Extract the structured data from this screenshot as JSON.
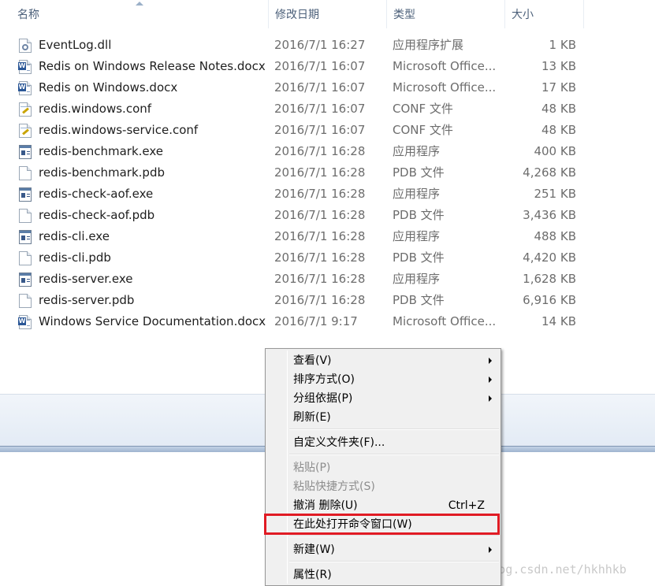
{
  "columns": {
    "name": "名称",
    "modified": "修改日期",
    "type": "类型",
    "size": "大小"
  },
  "files": [
    {
      "name": "EventLog.dll",
      "modified": "2016/7/1 16:27",
      "type": "应用程序扩展",
      "size": "1 KB",
      "icon": "dll-file-icon"
    },
    {
      "name": "Redis on Windows Release Notes.docx",
      "modified": "2016/7/1 16:07",
      "type": "Microsoft Office...",
      "size": "13 KB",
      "icon": "word-document-icon"
    },
    {
      "name": "Redis on Windows.docx",
      "modified": "2016/7/1 16:07",
      "type": "Microsoft Office...",
      "size": "17 KB",
      "icon": "word-document-icon"
    },
    {
      "name": "redis.windows.conf",
      "modified": "2016/7/1 16:07",
      "type": "CONF 文件",
      "size": "48 KB",
      "icon": "config-file-icon"
    },
    {
      "name": "redis.windows-service.conf",
      "modified": "2016/7/1 16:07",
      "type": "CONF 文件",
      "size": "48 KB",
      "icon": "config-file-icon"
    },
    {
      "name": "redis-benchmark.exe",
      "modified": "2016/7/1 16:28",
      "type": "应用程序",
      "size": "400 KB",
      "icon": "exe-file-icon"
    },
    {
      "name": "redis-benchmark.pdb",
      "modified": "2016/7/1 16:28",
      "type": "PDB 文件",
      "size": "4,268 KB",
      "icon": "blank-file-icon"
    },
    {
      "name": "redis-check-aof.exe",
      "modified": "2016/7/1 16:28",
      "type": "应用程序",
      "size": "251 KB",
      "icon": "exe-file-icon"
    },
    {
      "name": "redis-check-aof.pdb",
      "modified": "2016/7/1 16:28",
      "type": "PDB 文件",
      "size": "3,436 KB",
      "icon": "blank-file-icon"
    },
    {
      "name": "redis-cli.exe",
      "modified": "2016/7/1 16:28",
      "type": "应用程序",
      "size": "488 KB",
      "icon": "exe-file-icon"
    },
    {
      "name": "redis-cli.pdb",
      "modified": "2016/7/1 16:28",
      "type": "PDB 文件",
      "size": "4,420 KB",
      "icon": "blank-file-icon"
    },
    {
      "name": "redis-server.exe",
      "modified": "2016/7/1 16:28",
      "type": "应用程序",
      "size": "1,628 KB",
      "icon": "exe-file-icon"
    },
    {
      "name": "redis-server.pdb",
      "modified": "2016/7/1 16:28",
      "type": "PDB 文件",
      "size": "6,916 KB",
      "icon": "blank-file-icon"
    },
    {
      "name": "Windows Service Documentation.docx",
      "modified": "2016/7/1 9:17",
      "type": "Microsoft Office...",
      "size": "14 KB",
      "icon": "word-document-icon"
    }
  ],
  "context_menu": {
    "view": "查看(V)",
    "sort_by": "排序方式(O)",
    "group_by": "分组依据(P)",
    "refresh": "刷新(E)",
    "customize_folder": "自定义文件夹(F)...",
    "paste": "粘贴(P)",
    "paste_shortcut": "粘贴快捷方式(S)",
    "undo_delete": "撤消 删除(U)",
    "undo_shortcut": "Ctrl+Z",
    "open_command_window": "在此处打开命令窗口(W)",
    "new": "新建(W)",
    "properties": "属性(R)"
  },
  "highlight_color": "#e01b24",
  "watermark": "http://blog.csdn.net/hkhhkb"
}
